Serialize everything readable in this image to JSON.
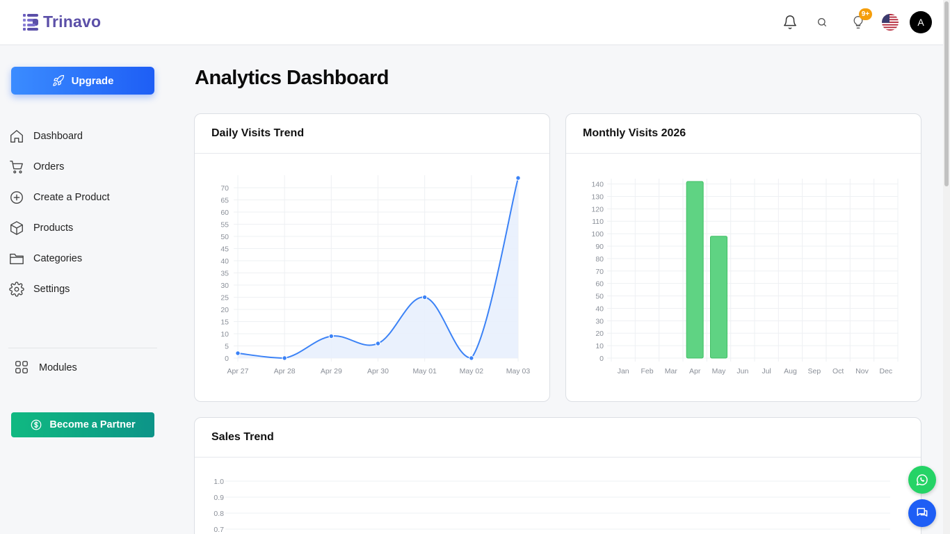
{
  "brand": {
    "name": "Trinavo"
  },
  "header": {
    "notifications_badge": "9+",
    "avatar_initial": "A",
    "icons": [
      "bell-icon",
      "search-icon",
      "lightbulb-icon",
      "us-flag-icon"
    ]
  },
  "sidebar": {
    "upgrade_label": "Upgrade",
    "items": [
      {
        "label": "Dashboard",
        "icon": "home-icon"
      },
      {
        "label": "Orders",
        "icon": "cart-icon"
      },
      {
        "label": "Create a Product",
        "icon": "plus-circle-icon"
      },
      {
        "label": "Products",
        "icon": "box-icon"
      },
      {
        "label": "Categories",
        "icon": "folder-icon"
      },
      {
        "label": "Settings",
        "icon": "gear-icon"
      }
    ],
    "modules_label": "Modules",
    "partner_label": "Become a Partner"
  },
  "main": {
    "title": "Analytics Dashboard",
    "cards": {
      "daily": {
        "title": "Daily Visits Trend"
      },
      "monthly": {
        "title": "Monthly Visits 2026"
      },
      "sales": {
        "title": "Sales Trend"
      }
    }
  },
  "colors": {
    "line": "#3b82f6",
    "line_fill": "#e8f0fd",
    "bar": "#5fd383",
    "bar_border": "#3fbf64",
    "accent_blue": "#1e5ef5",
    "accent_green": "#10b981"
  },
  "chart_data": [
    {
      "type": "area",
      "title": "Daily Visits Trend",
      "x": [
        "Apr 27",
        "Apr 28",
        "Apr 29",
        "Apr 30",
        "May 01",
        "May 02",
        "May 03"
      ],
      "values": [
        2,
        0,
        9,
        6,
        25,
        0,
        74
      ],
      "ylim": [
        0,
        74
      ],
      "yticks": [
        0,
        5,
        10,
        15,
        20,
        25,
        30,
        35,
        40,
        45,
        50,
        55,
        60,
        65,
        70
      ],
      "grid": true
    },
    {
      "type": "bar",
      "title": "Monthly Visits 2026",
      "categories": [
        "Jan",
        "Feb",
        "Mar",
        "Apr",
        "May",
        "Jun",
        "Jul",
        "Aug",
        "Sep",
        "Oct",
        "Nov",
        "Dec"
      ],
      "values": [
        0,
        0,
        0,
        142,
        98,
        0,
        0,
        0,
        0,
        0,
        0,
        0
      ],
      "ylim": [
        0,
        142
      ],
      "yticks": [
        0,
        10,
        20,
        30,
        40,
        50,
        60,
        70,
        80,
        90,
        100,
        110,
        120,
        130,
        140
      ],
      "grid": true
    },
    {
      "type": "line",
      "title": "Sales Trend",
      "yticks": [
        1.0,
        0.9,
        0.8,
        0.7
      ],
      "ylim": [
        0,
        1.0
      ],
      "grid": true
    }
  ]
}
